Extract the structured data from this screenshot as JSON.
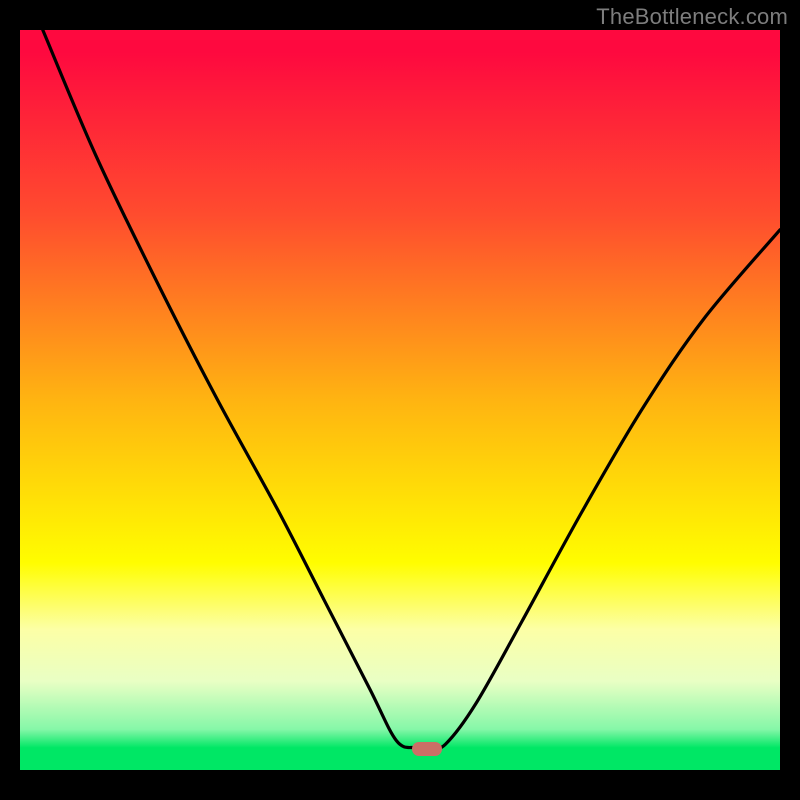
{
  "watermark": "TheBottleneck.com",
  "marker": {
    "x_frac": 0.535,
    "y_frac": 0.972
  },
  "chart_data": {
    "type": "line",
    "title": "",
    "xlabel": "",
    "ylabel": "",
    "xlim": [
      0,
      1
    ],
    "ylim": [
      0,
      1
    ],
    "grid": false,
    "legend": false,
    "annotations": [
      "TheBottleneck.com"
    ],
    "series": [
      {
        "name": "bottleneck-curve",
        "x": [
          0.03,
          0.1,
          0.18,
          0.26,
          0.34,
          0.4,
          0.46,
          0.495,
          0.52,
          0.54,
          0.56,
          0.6,
          0.66,
          0.74,
          0.82,
          0.9,
          1.0
        ],
        "y": [
          1.0,
          0.83,
          0.66,
          0.5,
          0.35,
          0.23,
          0.11,
          0.04,
          0.03,
          0.03,
          0.035,
          0.09,
          0.2,
          0.35,
          0.49,
          0.61,
          0.73
        ]
      }
    ],
    "background_gradient": {
      "orientation": "vertical",
      "stops": [
        {
          "pos": 0.0,
          "color": "#fe093f"
        },
        {
          "pos": 0.25,
          "color": "#ff4c2e"
        },
        {
          "pos": 0.5,
          "color": "#ffb411"
        },
        {
          "pos": 0.72,
          "color": "#fffd00"
        },
        {
          "pos": 0.88,
          "color": "#e9ffc4"
        },
        {
          "pos": 1.0,
          "color": "#00e765"
        }
      ]
    },
    "marker": {
      "x": 0.535,
      "y": 0.028,
      "shape": "pill",
      "color": "#cc6f66"
    }
  }
}
